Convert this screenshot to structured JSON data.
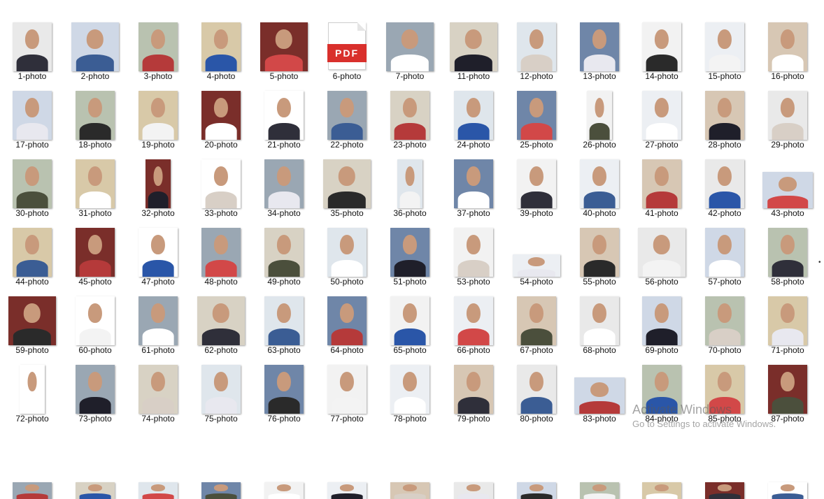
{
  "grid": {
    "columns": 13,
    "rows": [
      [
        "1-photo",
        "2-photo",
        "3-photo",
        "4-photo",
        "5-photo",
        "6-photo",
        "7-photo",
        "11-photo",
        "12-photo",
        "13-photo",
        "14-photo",
        "15-photo",
        "16-photo"
      ],
      [
        "17-photo",
        "18-photo",
        "19-photo",
        "20-photo",
        "21-photo",
        "22-photo",
        "23-photo",
        "24-photo",
        "25-photo",
        "26-photo",
        "27-photo",
        "28-photo",
        "29-photo"
      ],
      [
        "30-photo",
        "31-photo",
        "32-photo",
        "33-photo",
        "34-photo",
        "35-photo",
        "36-photo",
        "37-photo",
        "39-photo",
        "40-photo",
        "41-photo",
        "42-photo",
        "43-photo"
      ],
      [
        "44-photo",
        "45-photo",
        "47-photo",
        "48-photo",
        "49-photo",
        "50-photo",
        "51-photo",
        "53-photo",
        "54-photo",
        "55-photo",
        "56-photo",
        "57-photo",
        "58-photo"
      ],
      [
        "59-photo",
        "60-photo",
        "61-photo",
        "62-photo",
        "63-photo",
        "64-photo",
        "65-photo",
        "66-photo",
        "67-photo",
        "68-photo",
        "69-photo",
        "70-photo",
        "71-photo"
      ],
      [
        "72-photo",
        "73-photo",
        "74-photo",
        "75-photo",
        "76-photo",
        "77-photo",
        "78-photo",
        "79-photo",
        "80-photo",
        "83-photo",
        "84-photo",
        "85-photo",
        "87-photo"
      ],
      [
        "",
        "",
        "",
        "",
        "",
        "",
        "",
        "",
        "",
        "",
        "",
        "",
        ""
      ]
    ],
    "pdf_item": "6-photo",
    "pdf_badge": "PDF"
  },
  "watermark": {
    "line1": "Activate Windows",
    "line2": "Go to Settings to activate Windows."
  },
  "colors": {
    "background": "#ffffff",
    "pdf_red": "#d9302c",
    "backgrounds": [
      "#e9e9e9",
      "#cfd8e6",
      "#b9c2b0",
      "#d8c9a8",
      "#7a2e2a",
      "#ffffff",
      "#9aa7b3",
      "#d8d2c4",
      "#dfe6ec",
      "#6f86a8",
      "#f2f2f2",
      "#eceff3",
      "#d7c7b4"
    ],
    "clothes": [
      "#2f2f3a",
      "#e8e8ef",
      "#4b4f3c",
      "#3b5d94",
      "#2a2a2a",
      "#ffffff",
      "#b53a3a",
      "#f3f3f3",
      "#1f1f2a",
      "#2a56a8",
      "#ffffff",
      "#d8cfc6",
      "#d24848"
    ]
  }
}
